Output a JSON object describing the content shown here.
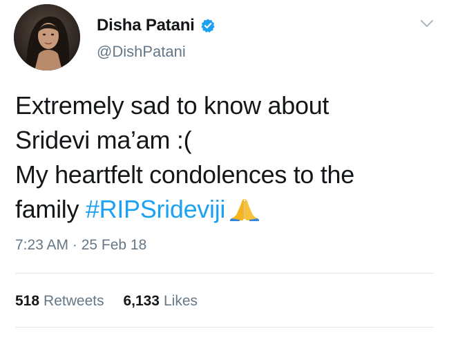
{
  "tweet": {
    "author": {
      "display_name": "Disha Patani",
      "handle": "@DishPatani",
      "verified": true,
      "avatar_icon": "profile-photo"
    },
    "text_lines": [
      "Extremely sad to know about",
      "Sridevi ma’am :(",
      "My heartfelt condolences to the"
    ],
    "last_line_prefix": "family ",
    "hashtag": "#RIPSrideviji",
    "emoji": "folded-hands",
    "timestamp": "7:23 AM · 25 Feb 18",
    "stats": {
      "retweets_count": "518",
      "retweets_label": "Retweets",
      "likes_count": "6,133",
      "likes_label": "Likes"
    }
  },
  "colors": {
    "link": "#1da1f2",
    "secondary_text": "#657786",
    "primary_text": "#14171a",
    "divider": "#e1e8ed",
    "emoji": "#f5b51f"
  }
}
